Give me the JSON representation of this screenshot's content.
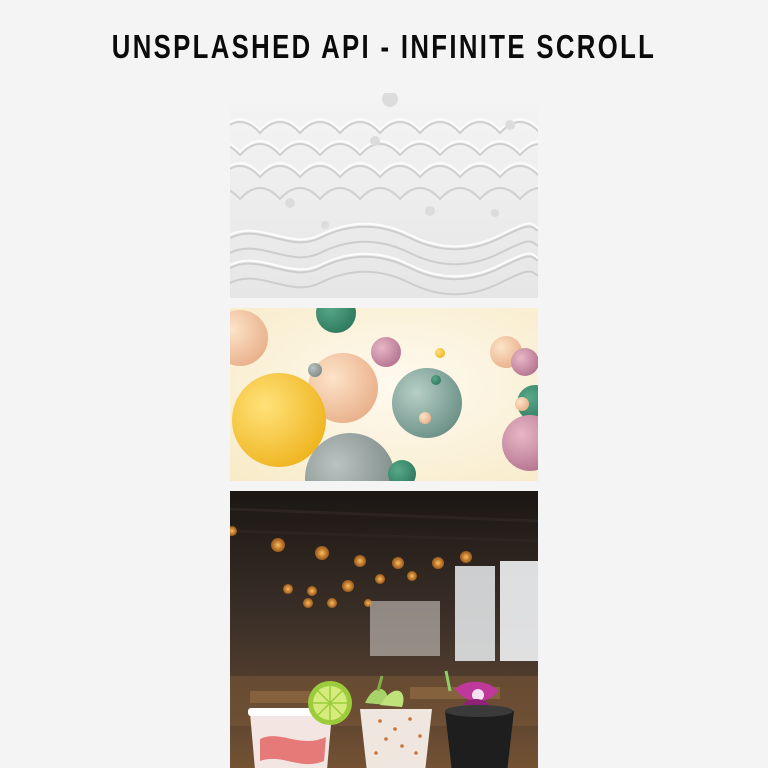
{
  "header": {
    "title": "Unsplashed API - Infinite Scroll"
  },
  "feed": {
    "photos": [
      {
        "subject": "white-paper-waves",
        "colors": {
          "base": "#ececec",
          "shade": "#d2d2d2",
          "light": "#fbfbfb"
        }
      },
      {
        "subject": "pastel-spheres",
        "colors": {
          "bg": "#fbf3d8",
          "yellow": "#f6c32a",
          "teal": "#7fa39b",
          "pink": "#c98fa3",
          "peach": "#f3cba8"
        }
      },
      {
        "subject": "cocktails-bokeh-bar",
        "colors": {
          "dark": "#2a211b",
          "wood": "#6a4a2c",
          "bokeh": "#f39a34",
          "window": "#e8e8e8"
        }
      }
    ]
  }
}
